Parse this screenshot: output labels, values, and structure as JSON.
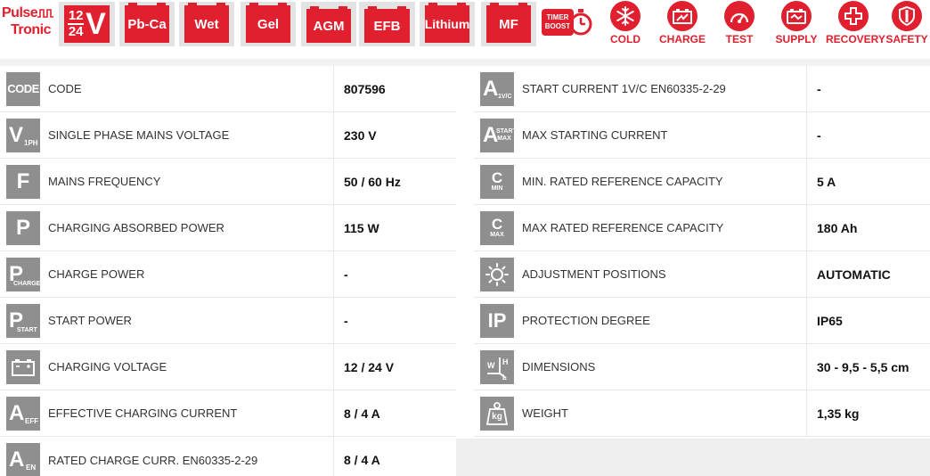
{
  "brand": {
    "line1": "Pulse",
    "line2": "Tronic",
    "color": "#e0202e"
  },
  "tiles": [
    {
      "id": "voltage",
      "top": "12",
      "bottom": "24",
      "unit": "V"
    },
    {
      "id": "pbca",
      "label": "Pb-Ca"
    },
    {
      "id": "wet",
      "label": "Wet"
    },
    {
      "id": "gel",
      "label": "Gel"
    },
    {
      "id": "agm",
      "label": "AGM"
    },
    {
      "id": "efb",
      "label": "EFB"
    },
    {
      "id": "lithium",
      "label": "Lithium"
    },
    {
      "id": "mf",
      "label": "MF"
    }
  ],
  "timer_boost": {
    "line1": "TIMER",
    "line2": "BOOST"
  },
  "features": [
    {
      "id": "cold",
      "label": "COLD",
      "icon": "snowflake-icon"
    },
    {
      "id": "charge",
      "label": "CHARGE",
      "icon": "battery-charge-icon"
    },
    {
      "id": "test",
      "label": "TEST",
      "icon": "gauge-icon"
    },
    {
      "id": "supply",
      "label": "SUPPLY",
      "icon": "battery-supply-icon"
    },
    {
      "id": "recovery",
      "label": "RECOVERY",
      "icon": "cross-icon"
    },
    {
      "id": "safety",
      "label": "SAFETY",
      "icon": "shield-icon"
    }
  ],
  "left_specs": [
    {
      "icon": "code-icon",
      "icon_text": "CODE",
      "icon_sub": "",
      "label": "CODE",
      "value": "807596"
    },
    {
      "icon": "voltage-1ph-icon",
      "icon_text": "V",
      "icon_sub": "1PH",
      "label": "SINGLE PHASE MAINS VOLTAGE",
      "value": "230 V"
    },
    {
      "icon": "frequency-icon",
      "icon_text": "F",
      "icon_sub": "",
      "label": "MAINS FREQUENCY",
      "value": "50 / 60 Hz"
    },
    {
      "icon": "power-icon",
      "icon_text": "P",
      "icon_sub": "",
      "label": "CHARGING ABSORBED POWER",
      "value": "115 W"
    },
    {
      "icon": "charge-power-icon",
      "icon_text": "P",
      "icon_sub": "CHARGE",
      "label": "CHARGE POWER",
      "value": "-"
    },
    {
      "icon": "start-power-icon",
      "icon_text": "P",
      "icon_sub": "START",
      "label": "START POWER",
      "value": "-"
    },
    {
      "icon": "battery-icon",
      "icon_text": "",
      "icon_sub": "",
      "label": "CHARGING VOLTAGE",
      "value": "12 / 24 V"
    },
    {
      "icon": "current-eff-icon",
      "icon_text": "A",
      "icon_sub": "EFF",
      "label": "EFFECTIVE CHARGING CURRENT",
      "value": "8 / 4 A"
    },
    {
      "icon": "current-en-icon",
      "icon_text": "A",
      "icon_sub": "EN",
      "label": "RATED CHARGE CURR. EN60335-2-29",
      "value": "8 / 4 A"
    }
  ],
  "right_specs": [
    {
      "icon": "start-current-icon",
      "icon_text": "A",
      "icon_sub": "1V/C",
      "label": "START CURRENT 1V/C EN60335-2-29",
      "value": "-"
    },
    {
      "icon": "max-start-icon",
      "icon_text": "A",
      "icon_sub": "START MAX",
      "label": "MAX STARTING CURRENT",
      "value": "-"
    },
    {
      "icon": "cmin-icon",
      "icon_text": "C",
      "icon_sub": "MIN",
      "label": "MIN. RATED REFERENCE CAPACITY",
      "value": "5 A"
    },
    {
      "icon": "cmax-icon",
      "icon_text": "C",
      "icon_sub": "MAX",
      "label": "MAX RATED REFERENCE CAPACITY",
      "value": "180 Ah"
    },
    {
      "icon": "adjust-icon",
      "icon_text": "",
      "icon_sub": "",
      "label": "ADJUSTMENT POSITIONS",
      "value": "AUTOMATIC"
    },
    {
      "icon": "ip-icon",
      "icon_text": "IP",
      "icon_sub": "",
      "label": "PROTECTION DEGREE",
      "value": "IP65"
    },
    {
      "icon": "dimensions-icon",
      "icon_text": "",
      "icon_sub": "",
      "label": "DIMENSIONS",
      "value": "30 - 9,5 - 5,5 cm"
    },
    {
      "icon": "weight-icon",
      "icon_text": "kg",
      "icon_sub": "",
      "label": "WEIGHT",
      "value": "1,35 kg"
    }
  ]
}
